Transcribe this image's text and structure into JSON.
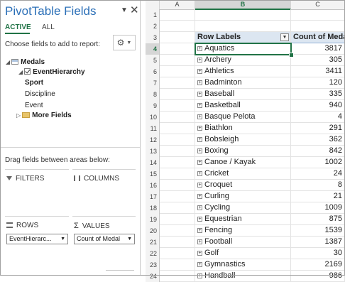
{
  "pane": {
    "title": "PivotTable Fields",
    "tabs": [
      {
        "label": "ACTIVE"
      },
      {
        "label": "ALL"
      }
    ],
    "choose_label": "Choose fields to add to report:",
    "fields": {
      "table": "Medals",
      "hierarchy": "EventHierarchy",
      "levels": [
        "Sport",
        "Discipline",
        "Event"
      ],
      "more": "More Fields"
    },
    "drag_label": "Drag fields between areas below:",
    "areas": {
      "filters": "FILTERS",
      "columns": "COLUMNS",
      "rows": "ROWS",
      "values": "VALUES",
      "rows_value": "EventHierarc...",
      "values_value": "Count of Medal"
    }
  },
  "sheet": {
    "columns": [
      "A",
      "B",
      "C"
    ],
    "active_column": "B",
    "active_row": 4,
    "header_row": 3,
    "header": {
      "row_labels": "Row Labels",
      "count_label": "Count of Medal"
    },
    "row_numbers": [
      1,
      2,
      3,
      4,
      5,
      6,
      7,
      8,
      9,
      10,
      11,
      12,
      13,
      14,
      15,
      16,
      17,
      18,
      19,
      20,
      21,
      22,
      23,
      24
    ],
    "rows": [
      {
        "label": "Aquatics",
        "count": "3817"
      },
      {
        "label": "Archery",
        "count": "305"
      },
      {
        "label": "Athletics",
        "count": "3411"
      },
      {
        "label": "Badminton",
        "count": "120"
      },
      {
        "label": "Baseball",
        "count": "335"
      },
      {
        "label": "Basketball",
        "count": "940"
      },
      {
        "label": "Basque Pelota",
        "count": "4"
      },
      {
        "label": "Biathlon",
        "count": "291"
      },
      {
        "label": "Bobsleigh",
        "count": "362"
      },
      {
        "label": "Boxing",
        "count": "842"
      },
      {
        "label": "Canoe / Kayak",
        "count": "1002"
      },
      {
        "label": "Cricket",
        "count": "24"
      },
      {
        "label": "Croquet",
        "count": "8"
      },
      {
        "label": "Curling",
        "count": "21"
      },
      {
        "label": "Cycling",
        "count": "1009"
      },
      {
        "label": "Equestrian",
        "count": "875"
      },
      {
        "label": "Fencing",
        "count": "1539"
      },
      {
        "label": "Football",
        "count": "1387"
      },
      {
        "label": "Golf",
        "count": "30"
      },
      {
        "label": "Gymnastics",
        "count": "2169"
      },
      {
        "label": "Handball",
        "count": "986"
      }
    ]
  }
}
